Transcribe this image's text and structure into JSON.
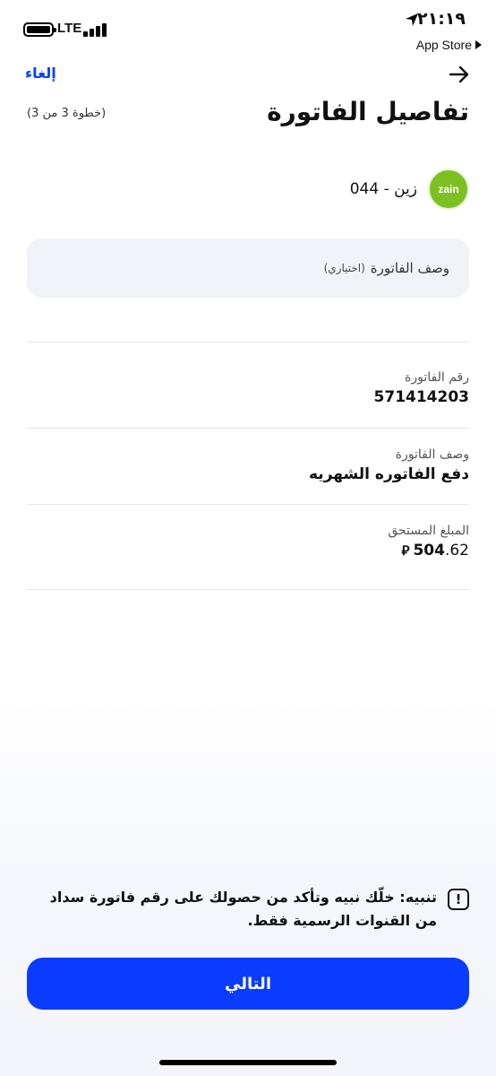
{
  "status_bar": {
    "network": "LTE",
    "time": "٢١:١٩",
    "back_app": "App Store"
  },
  "header": {
    "cancel_label": "إلغاء",
    "title": "تفاصيل الفاتورة",
    "step": "(خطوة 3 من 3)"
  },
  "provider": {
    "logo_text": "zain",
    "name": "044 - زين",
    "brand_color": "#7cc022"
  },
  "description_field": {
    "placeholder": "وصف الفاتورة",
    "optional_hint": "(اختياري)",
    "value": ""
  },
  "details": [
    {
      "label": "رقم الفاتورة",
      "value": "571414203"
    },
    {
      "label": "وصف الفاتورة",
      "value": "دفع الفاتوره الشهريه"
    },
    {
      "label": "المبلغ المستحق",
      "amount_int": "504",
      "amount_dec": ".62",
      "currency_icon": "riyal-icon"
    }
  ],
  "warning": {
    "icon": "exclamation-icon",
    "text": "تنبيه: خلّك نبيه وتأكد من حصولك على رقم فاتورة سداد من القنوات الرسمية فقط."
  },
  "next_button": {
    "label": "التالي",
    "color": "#0a3cff"
  },
  "accent_color": "#0040ff"
}
